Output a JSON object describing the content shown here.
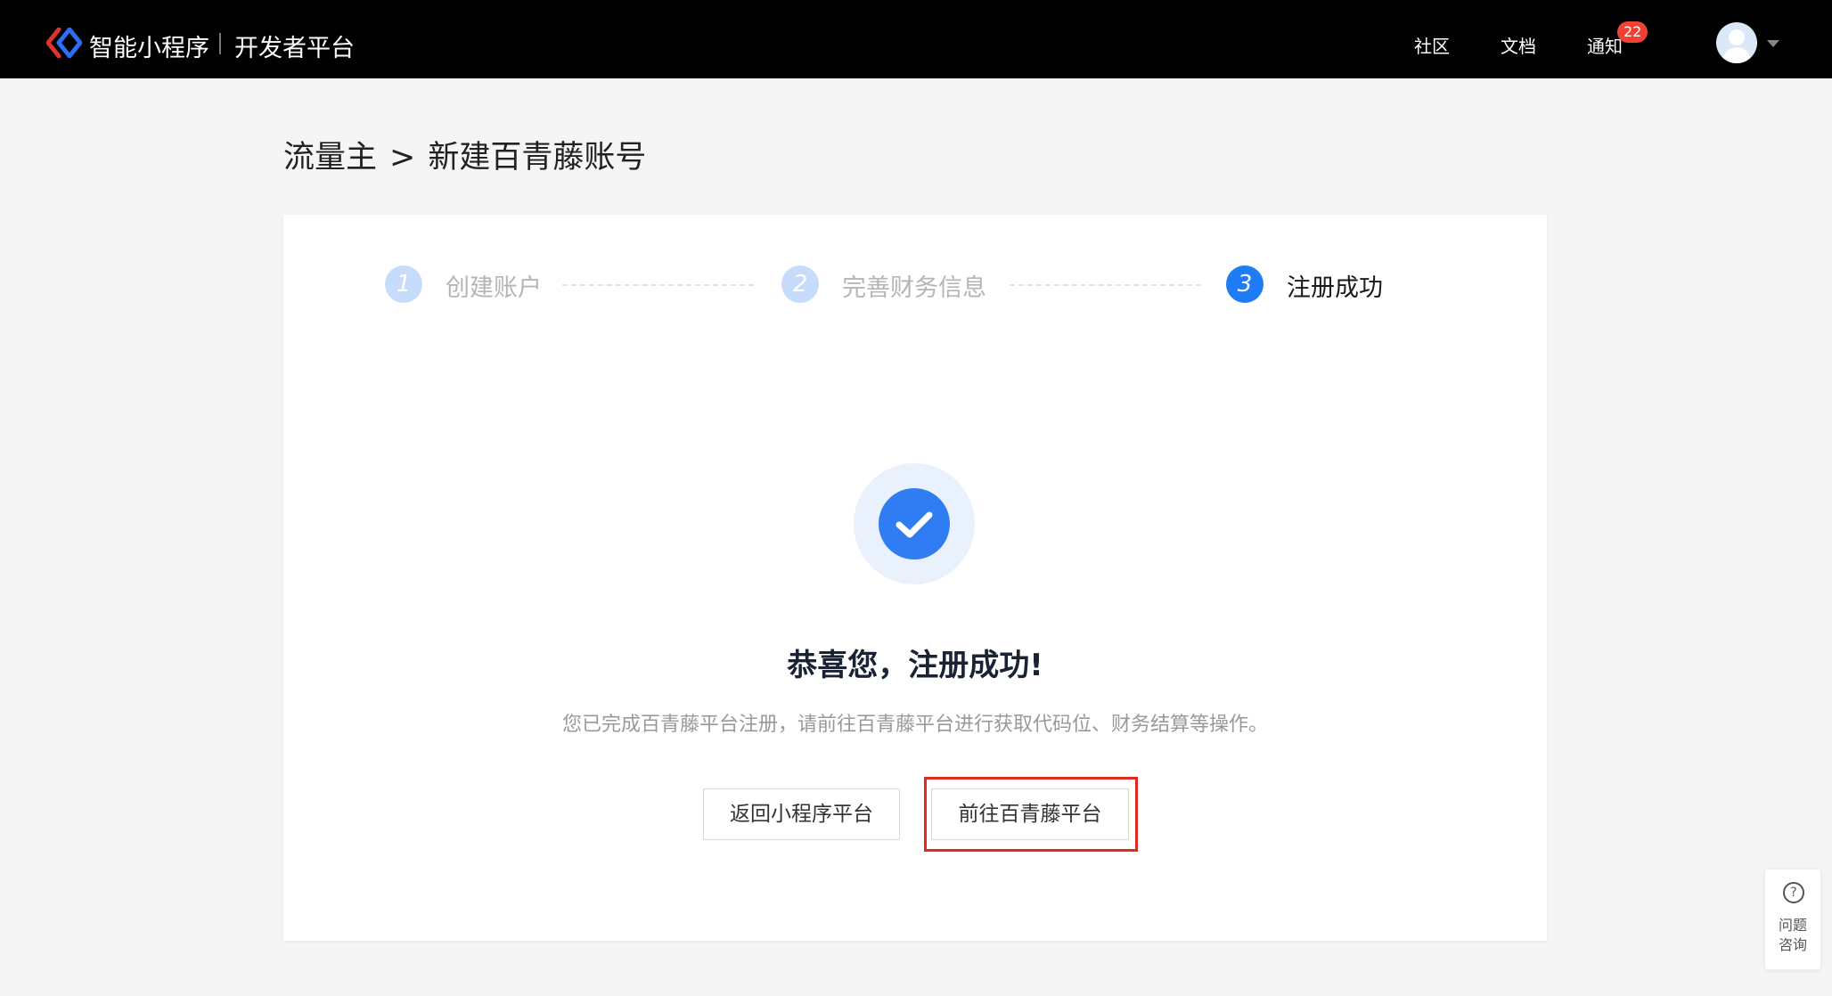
{
  "header": {
    "brand": "智能小程序",
    "platform": "开发者平台",
    "nav": [
      {
        "label": "社区"
      },
      {
        "label": "文档"
      },
      {
        "label": "通知"
      }
    ],
    "notification_count": "22"
  },
  "breadcrumb": {
    "parent": "流量主",
    "separator": ">",
    "current": "新建百青藤账号"
  },
  "steps": [
    {
      "number": "1",
      "label": "创建账户",
      "state": "inactive"
    },
    {
      "number": "2",
      "label": "完善财务信息",
      "state": "inactive"
    },
    {
      "number": "3",
      "label": "注册成功",
      "state": "active"
    }
  ],
  "result": {
    "title": "恭喜您，注册成功!",
    "description": "您已完成百青藤平台注册，请前往百青藤平台进行获取代码位、财务结算等操作。"
  },
  "actions": {
    "back_label": "返回小程序平台",
    "goto_label": "前往百青藤平台"
  },
  "help": {
    "line1": "问题",
    "line2": "咨询",
    "icon": "?"
  },
  "colors": {
    "header_bg": "#000000",
    "accent": "#1f7cf5",
    "badge": "#f04134",
    "highlight": "#e1281e"
  }
}
